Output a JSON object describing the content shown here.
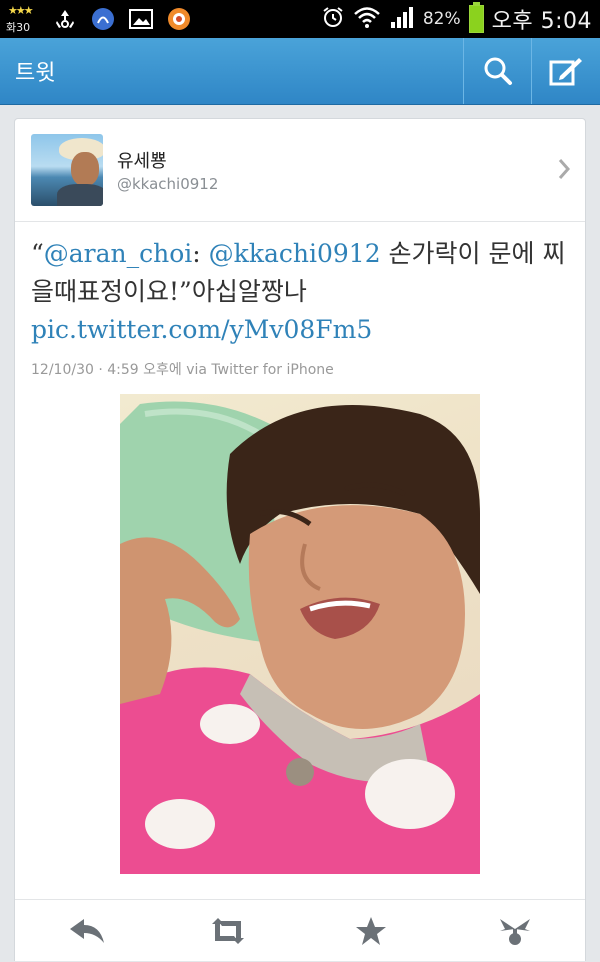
{
  "status_bar": {
    "weather_temp": "화30",
    "battery_percent": "82%",
    "time": "오후 5:04",
    "icons": [
      "weather-icon",
      "recycle-icon",
      "app-icon",
      "gallery-icon",
      "app2-icon",
      "alarm-icon",
      "wifi-icon",
      "signal-icon",
      "battery-icon"
    ]
  },
  "action_bar": {
    "title": "트윗",
    "color": "#3a93cf",
    "buttons": [
      "search-icon",
      "compose-icon"
    ]
  },
  "tweet": {
    "user_name": "유세뿅",
    "user_handle": "@kkachi0912",
    "text_parts": {
      "open_quote": "“",
      "mention1": "@aran_choi",
      "colon": ": ",
      "mention2": "@kkachi0912",
      "body": " 손가락이 문에 찌을때표정이요!”아십알짱나 ",
      "link": "pic.twitter.com/yMv08Fm5"
    },
    "meta": "12/10/30 · 4:59 오후에 via Twitter for iPhone",
    "link_color": "#2f82b8"
  },
  "tweet_actions": [
    "reply-icon",
    "retweet-icon",
    "favorite-icon",
    "more-icon"
  ]
}
